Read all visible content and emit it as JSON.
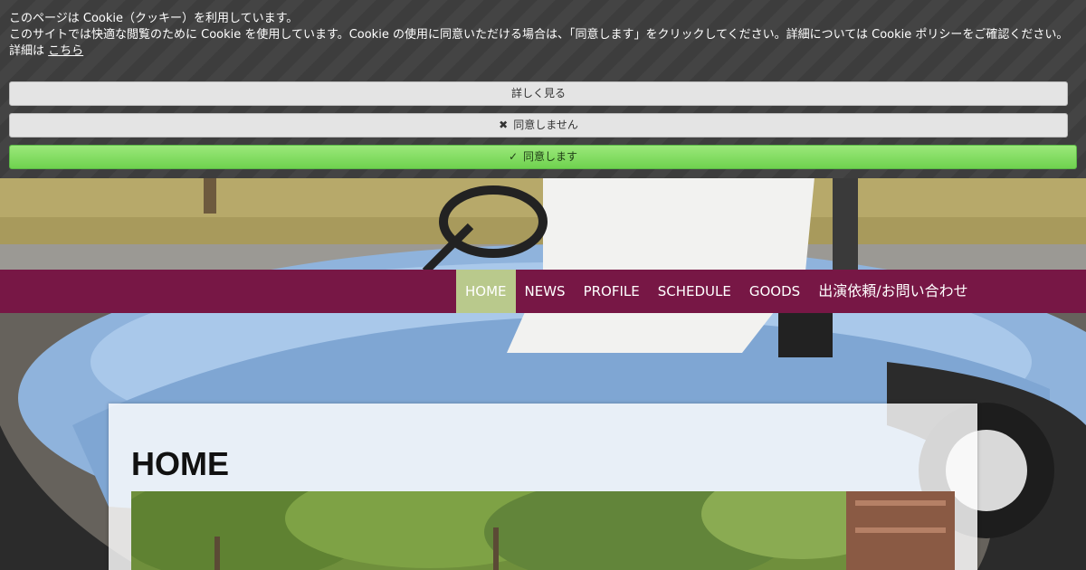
{
  "cookie": {
    "line1": "このページは Cookie（クッキー）を利用しています。",
    "line2": "このサイトでは快適な閲覧のために Cookie を使用しています。Cookie の使用に同意いただける場合は、「同意します」をクリックしてください。詳細については Cookie ポリシーをご確認ください。",
    "details_prefix": "詳細は",
    "details_link": "こちら",
    "buttons": {
      "more": "詳しく見る",
      "decline": "同意しません",
      "accept": "同意します"
    },
    "icons": {
      "decline": "close-icon",
      "accept": "check-icon"
    }
  },
  "nav": {
    "items": [
      {
        "label": "HOME",
        "active": true
      },
      {
        "label": "NEWS"
      },
      {
        "label": "PROFILE"
      },
      {
        "label": "SCHEDULE"
      },
      {
        "label": "GOODS"
      },
      {
        "label": "出演依頼/お問い合わせ"
      }
    ]
  },
  "main": {
    "title": "HOME"
  },
  "colors": {
    "nav_bg": "#771745",
    "nav_active": "#b9c98c",
    "accept_button": "#7ddc5e",
    "banner_bg": "#3d3d3d"
  }
}
